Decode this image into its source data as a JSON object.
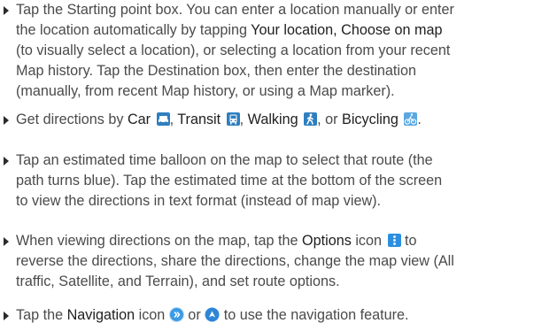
{
  "colors": {
    "body_text": "#4a4a4a",
    "keyword": "#1e1e1e",
    "icon_blue": "#2f7fc0",
    "options_blue": "#2d8fe0",
    "bike_blue": "#5ba7e0"
  },
  "p1": {
    "lines": [
      "Tap the Starting point box. You can enter a location manually or enter",
      "the location automatically by tapping ",
      "(to visually select a location), or selecting a location from your recent",
      "Map history. Tap the Destination box, then enter the destination",
      "(manually, from recent Map history, or using a Map marker)."
    ],
    "kw_your_location": "Your location",
    "sep": ", ",
    "kw_choose_on_map": "Choose on map"
  },
  "p2": {
    "prefix": "Get directions by ",
    "car": "Car",
    "comma1": ", ",
    "transit": "Transit",
    "comma2": ", ",
    "walking": "Walking",
    "or": ", or ",
    "bicycling": "Bicycling",
    "end": "."
  },
  "p3": {
    "lines": [
      "Tap an estimated time balloon on the map to select that route (the",
      "path turns blue). Tap the estimated time at the bottom of the screen",
      "to view the directions in text format (instead of map view)."
    ]
  },
  "p4": {
    "line1_prefix": "When viewing directions on the map, tap the ",
    "options": "Options",
    "line1_mid": " icon ",
    "line1_end": " to",
    "lines": [
      "reverse the directions, share the directions, change the map view (All",
      "traffic, Satellite, and Terrain), and set route options."
    ]
  },
  "p5": {
    "prefix": "Tap the ",
    "navigation": "Navigation",
    "mid": " icon ",
    "or": " or ",
    "end": " to use the navigation feature."
  },
  "icons": {
    "car": "car-icon",
    "transit": "transit-icon",
    "walking": "walking-icon",
    "bicycling": "bicycling-icon",
    "options": "options-icon",
    "nav1": "navigation-icon",
    "nav2": "navigation-arrow-icon"
  }
}
